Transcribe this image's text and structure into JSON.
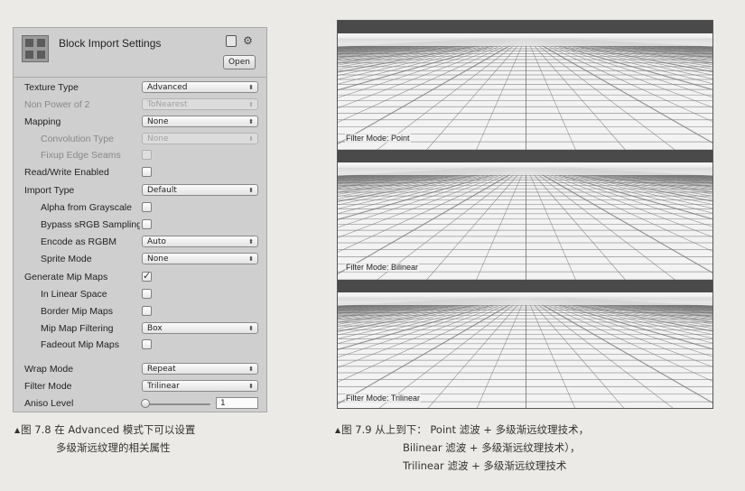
{
  "inspector": {
    "title": "Block Import Settings",
    "open_label": "Open",
    "header_icons": [
      "book-icon",
      "gear-icon"
    ],
    "rows": [
      {
        "label": "Texture Type",
        "control": "dropdown",
        "value": "Advanced",
        "indent": false,
        "disabled": false
      },
      {
        "label": "Non Power of 2",
        "control": "dropdown",
        "value": "ToNearest",
        "indent": false,
        "disabled": true
      },
      {
        "label": "Mapping",
        "control": "dropdown",
        "value": "None",
        "indent": false,
        "disabled": false
      },
      {
        "label": "Convolution Type",
        "control": "dropdown",
        "value": "None",
        "indent": true,
        "disabled": true
      },
      {
        "label": "Fixup Edge Seams",
        "control": "checkbox",
        "checked": false,
        "indent": true,
        "disabled": true
      },
      {
        "label": "Read/Write Enabled",
        "control": "checkbox",
        "checked": false,
        "indent": false,
        "disabled": false
      },
      {
        "label": "Import Type",
        "control": "dropdown",
        "value": "Default",
        "indent": false,
        "disabled": false
      },
      {
        "label": "Alpha from Grayscale",
        "control": "checkbox",
        "checked": false,
        "indent": true,
        "disabled": false
      },
      {
        "label": "Bypass sRGB Sampling",
        "control": "checkbox",
        "checked": false,
        "indent": true,
        "disabled": false
      },
      {
        "label": "Encode as RGBM",
        "control": "dropdown",
        "value": "Auto",
        "indent": true,
        "disabled": false
      },
      {
        "label": "Sprite Mode",
        "control": "dropdown",
        "value": "None",
        "indent": true,
        "disabled": false
      },
      {
        "label": "Generate Mip Maps",
        "control": "checkbox",
        "checked": true,
        "indent": false,
        "disabled": false
      },
      {
        "label": "In Linear Space",
        "control": "checkbox",
        "checked": false,
        "indent": true,
        "disabled": false
      },
      {
        "label": "Border Mip Maps",
        "control": "checkbox",
        "checked": false,
        "indent": true,
        "disabled": false
      },
      {
        "label": "Mip Map Filtering",
        "control": "dropdown",
        "value": "Box",
        "indent": true,
        "disabled": false
      },
      {
        "label": "Fadeout Mip Maps",
        "control": "checkbox",
        "checked": false,
        "indent": true,
        "disabled": false
      },
      {
        "label": "Wrap Mode",
        "control": "dropdown",
        "value": "Repeat",
        "indent": false,
        "disabled": false
      },
      {
        "label": "Filter Mode",
        "control": "dropdown",
        "value": "Trilinear",
        "indent": false,
        "disabled": false
      },
      {
        "label": "Aniso Level",
        "control": "slider",
        "value": "1",
        "indent": false,
        "disabled": false
      }
    ]
  },
  "filter_image": {
    "panels": [
      {
        "mode_label": "Filter Mode: Point"
      },
      {
        "mode_label": "Filter Mode: Bilinear"
      },
      {
        "mode_label": "Filter Mode: Trilinear"
      }
    ]
  },
  "captions": {
    "mark": "▲",
    "fig78_line1": "图 7.8  在 Advanced 模式下可以设置",
    "fig78_line2": "多级渐远纹理的相关属性",
    "fig79_line1": "图 7.9  从上到下： Point 滤波 + 多级渐远纹理技术，",
    "fig79_line2": "Bilinear 滤波 + 多级渐远纹理技术），",
    "fig79_line3": "Trilinear 滤波 + 多级渐远纹理技术"
  }
}
